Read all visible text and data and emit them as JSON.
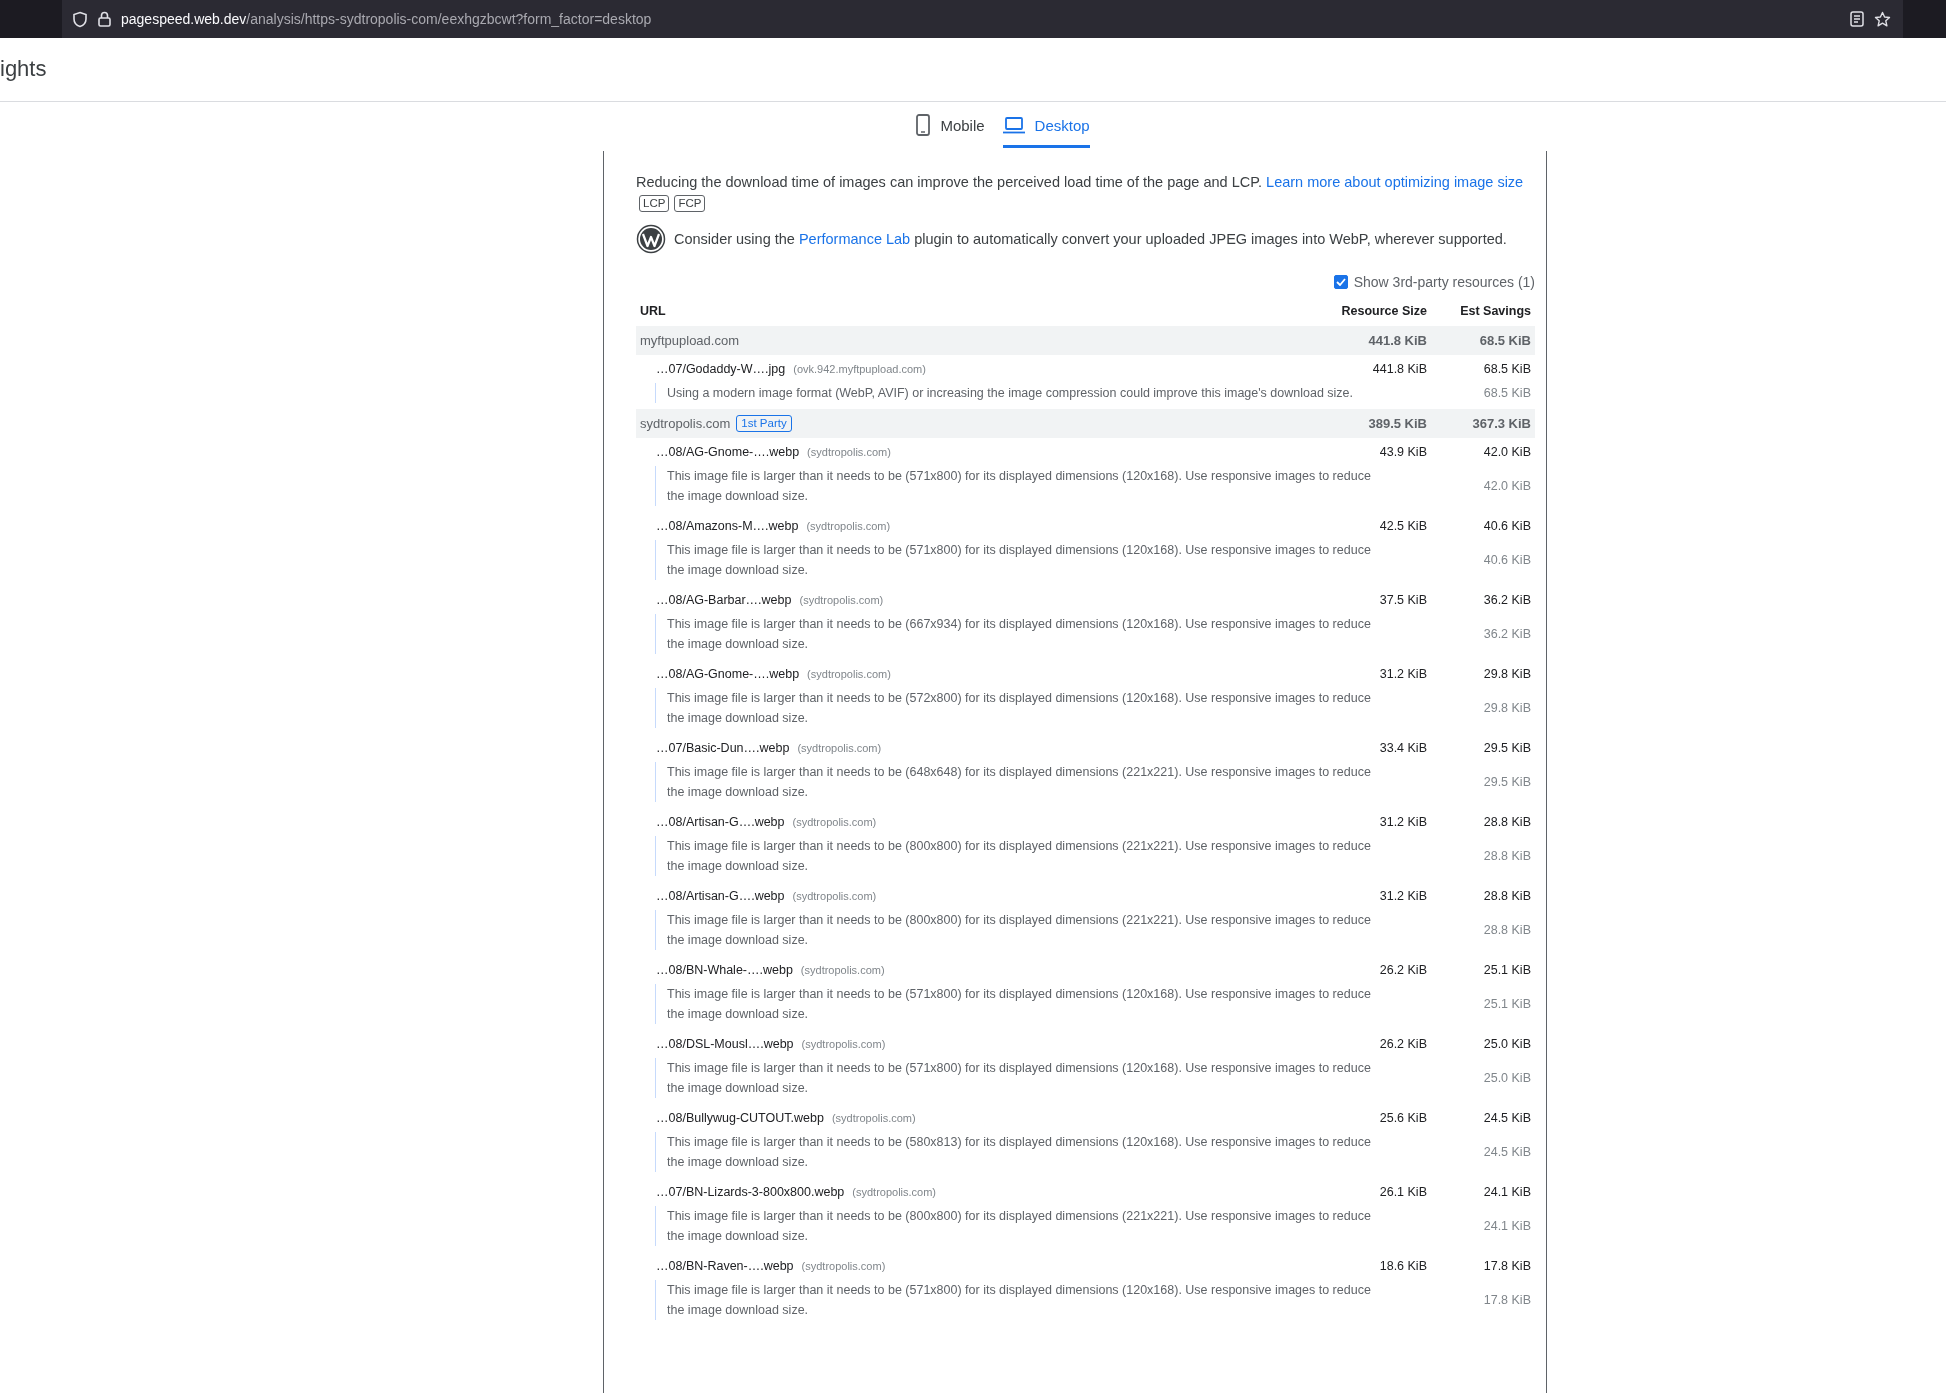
{
  "browser": {
    "url": "**pagespeed.web.dev**/analysis/https-sydtropolis-com/eexhgzbcwt?form_factor=desktop"
  },
  "header": {
    "title": "ights"
  },
  "tabs": [
    {
      "label": "Mobile",
      "kind": "phone",
      "selected": false
    },
    {
      "label": "Desktop",
      "kind": "laptop",
      "selected": true
    }
  ],
  "audit": {
    "description": "Reducing the download time of images can improve the perceived load time of the page and LCP.",
    "link": "Learn more about optimizing image size",
    "tags": [
      "LCP",
      "FCP"
    ],
    "plugin_note": {
      "before": "Consider using the",
      "link": "Performance Lab",
      "after": "plugin to automatically convert your uploaded JPEG images into WebP, wherever supported."
    },
    "third_party": {
      "label": "Show 3rd-party resources (1)",
      "checked": true
    },
    "table": {
      "columns": [
        "URL",
        "Resource Size",
        "Est Savings"
      ],
      "groups": [
        {
          "name": "myftpupload.com",
          "size": "441.8 KiB",
          "savings": "68.5 KiB",
          "items": [
            {
              "url": "…07/Godaddy-W….jpg",
              "host": "(ovk.942.myftpupload.com)",
              "size": "441.8 KiB",
              "savings": "68.5 KiB",
              "description": "Using a modern image format (WebP, AVIF) or increasing the image compression could improve this image's download size.",
              "description_savings": "68.5 KiB"
            }
          ]
        },
        {
          "name": "sydtropolis.com",
          "badge": "1st Party",
          "size": "389.5 KiB",
          "savings": "367.3 KiB",
          "items": [
            {
              "url": "…08/AG-Gnome-….webp",
              "host": "(sydtropolis.com)",
              "size": "43.9 KiB",
              "savings": "42.0 KiB",
              "description": "This image file is larger than it needs to be (571x800) for its displayed dimensions (120x168). Use responsive images to reduce the image download size.",
              "description_savings": "42.0 KiB"
            },
            {
              "url": "…08/Amazons-M….webp",
              "host": "(sydtropolis.com)",
              "size": "42.5 KiB",
              "savings": "40.6 KiB",
              "description": "This image file is larger than it needs to be (571x800) for its displayed dimensions (120x168). Use responsive images to reduce the image download size.",
              "description_savings": "40.6 KiB"
            },
            {
              "url": "…08/AG-Barbar….webp",
              "host": "(sydtropolis.com)",
              "size": "37.5 KiB",
              "savings": "36.2 KiB",
              "description": "This image file is larger than it needs to be (667x934) for its displayed dimensions (120x168). Use responsive images to reduce the image download size.",
              "description_savings": "36.2 KiB"
            },
            {
              "url": "…08/AG-Gnome-….webp",
              "host": "(sydtropolis.com)",
              "size": "31.2 KiB",
              "savings": "29.8 KiB",
              "description": "This image file is larger than it needs to be (572x800) for its displayed dimensions (120x168). Use responsive images to reduce the image download size.",
              "description_savings": "29.8 KiB"
            },
            {
              "url": "…07/Basic-Dun….webp",
              "host": "(sydtropolis.com)",
              "size": "33.4 KiB",
              "savings": "29.5 KiB",
              "description": "This image file is larger than it needs to be (648x648) for its displayed dimensions (221x221). Use responsive images to reduce the image download size.",
              "description_savings": "29.5 KiB"
            },
            {
              "url": "…08/Artisan-G….webp",
              "host": "(sydtropolis.com)",
              "size": "31.2 KiB",
              "savings": "28.8 KiB",
              "description": "This image file is larger than it needs to be (800x800) for its displayed dimensions (221x221). Use responsive images to reduce the image download size.",
              "description_savings": "28.8 KiB"
            },
            {
              "url": "…08/Artisan-G….webp",
              "host": "(sydtropolis.com)",
              "size": "31.2 KiB",
              "savings": "28.8 KiB",
              "description": "This image file is larger than it needs to be (800x800) for its displayed dimensions (221x221). Use responsive images to reduce the image download size.",
              "description_savings": "28.8 KiB"
            },
            {
              "url": "…08/BN-Whale-….webp",
              "host": "(sydtropolis.com)",
              "size": "26.2 KiB",
              "savings": "25.1 KiB",
              "description": "This image file is larger than it needs to be (571x800) for its displayed dimensions (120x168). Use responsive images to reduce the image download size.",
              "description_savings": "25.1 KiB"
            },
            {
              "url": "…08/DSL-Mousl….webp",
              "host": "(sydtropolis.com)",
              "size": "26.2 KiB",
              "savings": "25.0 KiB",
              "description": "This image file is larger than it needs to be (571x800) for its displayed dimensions (120x168). Use responsive images to reduce the image download size.",
              "description_savings": "25.0 KiB"
            },
            {
              "url": "…08/Bullywug-CUTOUT.webp",
              "host": "(sydtropolis.com)",
              "size": "25.6 KiB",
              "savings": "24.5 KiB",
              "description": "This image file is larger than it needs to be (580x813) for its displayed dimensions (120x168). Use responsive images to reduce the image download size.",
              "description_savings": "24.5 KiB"
            },
            {
              "url": "…07/BN-Lizards-3-800x800.webp",
              "host": "(sydtropolis.com)",
              "size": "26.1 KiB",
              "savings": "24.1 KiB",
              "description": "This image file is larger than it needs to be (800x800) for its displayed dimensions (221x221). Use responsive images to reduce the image download size.",
              "description_savings": "24.1 KiB"
            },
            {
              "url": "…08/BN-Raven-….webp",
              "host": "(sydtropolis.com)",
              "size": "18.6 KiB",
              "savings": "17.8 KiB",
              "description": "This image file is larger than it needs to be (571x800) for its displayed dimensions (120x168). Use responsive images to reduce the image download size.",
              "description_savings": "17.8 KiB"
            }
          ]
        }
      ]
    }
  }
}
